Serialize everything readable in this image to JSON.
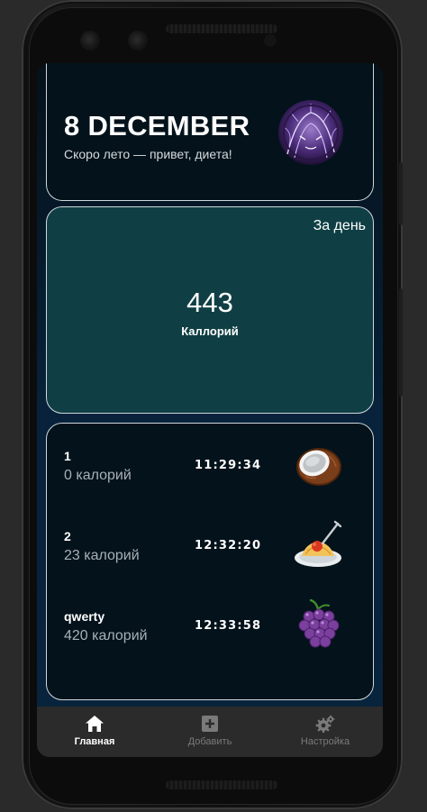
{
  "header": {
    "date": "8 DECEMBER",
    "subtitle": "Скоро лето — привет, диета!"
  },
  "daily_stats": {
    "period_label": "За день",
    "calories_value": "443",
    "calories_label": "Каллорий"
  },
  "entries": [
    {
      "name": "1",
      "calories": "0 калорий",
      "time": "11:29:34",
      "icon": "coconut-icon"
    },
    {
      "name": "2",
      "calories": "23 калорий",
      "time": "12:32:20",
      "icon": "spaghetti-icon"
    },
    {
      "name": "qwerty",
      "calories": "420 калорий",
      "time": "12:33:58",
      "icon": "grapes-icon"
    }
  ],
  "navbar": {
    "items": [
      {
        "label": "Главная",
        "icon": "home-icon",
        "active": true
      },
      {
        "label": "Добавить",
        "icon": "add-box-icon",
        "active": false
      },
      {
        "label": "Настройка",
        "icon": "settings-gears-icon",
        "active": false
      }
    ]
  },
  "colors": {
    "accent_card": "#0f3f44",
    "dark_card": "#03121b",
    "navbar_bg": "#2b2b2b",
    "nav_inactive": "#7a7a7a"
  }
}
